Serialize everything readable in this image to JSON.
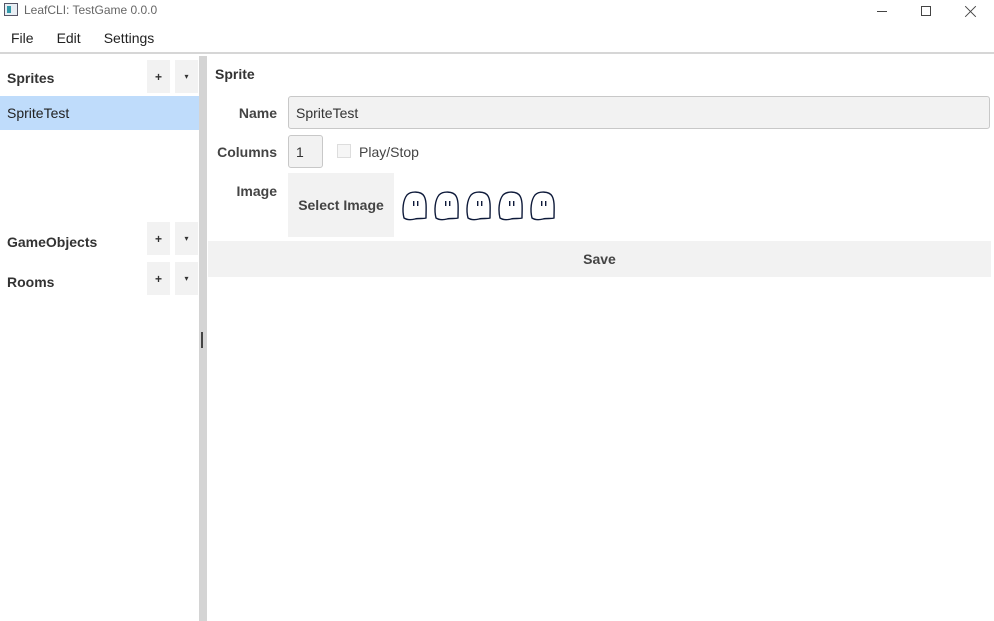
{
  "window": {
    "title": "LeafCLI: TestGame 0.0.0"
  },
  "menubar": {
    "items": [
      "File",
      "Edit",
      "Settings"
    ]
  },
  "sidebar": {
    "sections": [
      {
        "title": "Sprites",
        "add_label": "+",
        "more_label": "▾",
        "items": [
          "SpriteTest"
        ],
        "selected": "SpriteTest"
      },
      {
        "title": "GameObjects",
        "add_label": "+",
        "more_label": "▾",
        "items": []
      },
      {
        "title": "Rooms",
        "add_label": "+",
        "more_label": "▾",
        "items": []
      }
    ]
  },
  "editor": {
    "title": "Sprite",
    "name_label": "Name",
    "name_value": "SpriteTest",
    "columns_label": "Columns",
    "columns_value": "1",
    "play_stop_label": "Play/Stop",
    "play_stop_checked": false,
    "image_label": "Image",
    "select_image_label": "Select Image",
    "preview_frame_count": 5,
    "save_label": "Save"
  },
  "colors": {
    "selection": "#bfdcfb",
    "button_bg": "#f2f2f2",
    "splitter": "#d4d4d4"
  }
}
